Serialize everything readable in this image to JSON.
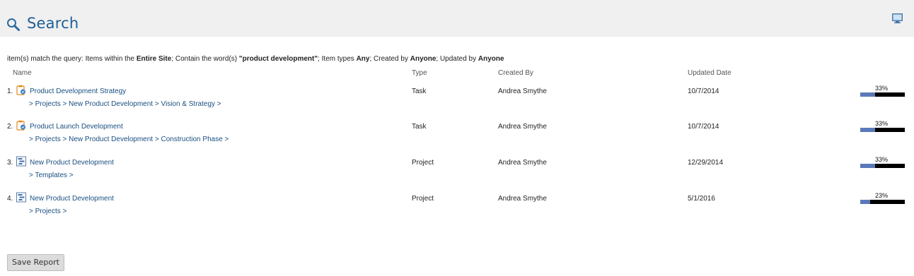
{
  "header": {
    "title": "Search"
  },
  "summary": {
    "prefix": "item(s) match the query: Items within the ",
    "scope": "Entire Site",
    "mid1": "; Contain the word(s) ",
    "words": "\"product development\"",
    "mid2": "; Item types ",
    "types": "Any",
    "mid3": "; Created by ",
    "created_by": "Anyone",
    "mid4": "; Updated by ",
    "updated_by": "Anyone"
  },
  "columns": {
    "name": "Name",
    "type": "Type",
    "created_by": "Created By",
    "updated_date": "Updated Date"
  },
  "results": [
    {
      "num": "1.",
      "icon": "task-icon",
      "name": "Product Development Strategy",
      "path": "> Projects > New Product Development > Vision & Strategy >",
      "type": "Task",
      "created_by": "Andrea Smythe",
      "updated": "10/7/2014",
      "progress_label": "33%",
      "progress": 0.33
    },
    {
      "num": "2.",
      "icon": "task-icon",
      "name": "Product Launch Development",
      "path": "> Projects > New Product Development > Construction Phase >",
      "type": "Task",
      "created_by": "Andrea Smythe",
      "updated": "10/7/2014",
      "progress_label": "33%",
      "progress": 0.33
    },
    {
      "num": "3.",
      "icon": "project-icon",
      "name": "New Product Development",
      "path": "> Templates >",
      "type": "Project",
      "created_by": "Andrea Smythe",
      "updated": "12/29/2014",
      "progress_label": "33%",
      "progress": 0.33
    },
    {
      "num": "4.",
      "icon": "project-icon",
      "name": "New Product Development",
      "path": "> Projects >",
      "type": "Project",
      "created_by": "Andrea Smythe",
      "updated": "5/1/2016",
      "progress_label": "23%",
      "progress": 0.23
    }
  ],
  "actions": {
    "save_report": "Save Report"
  },
  "colors": {
    "title": "#1f5f96",
    "link": "#1a4f80",
    "progress_fill": "#5a79b8",
    "progress_track": "#000000",
    "header_bg": "#f0f0f0"
  }
}
